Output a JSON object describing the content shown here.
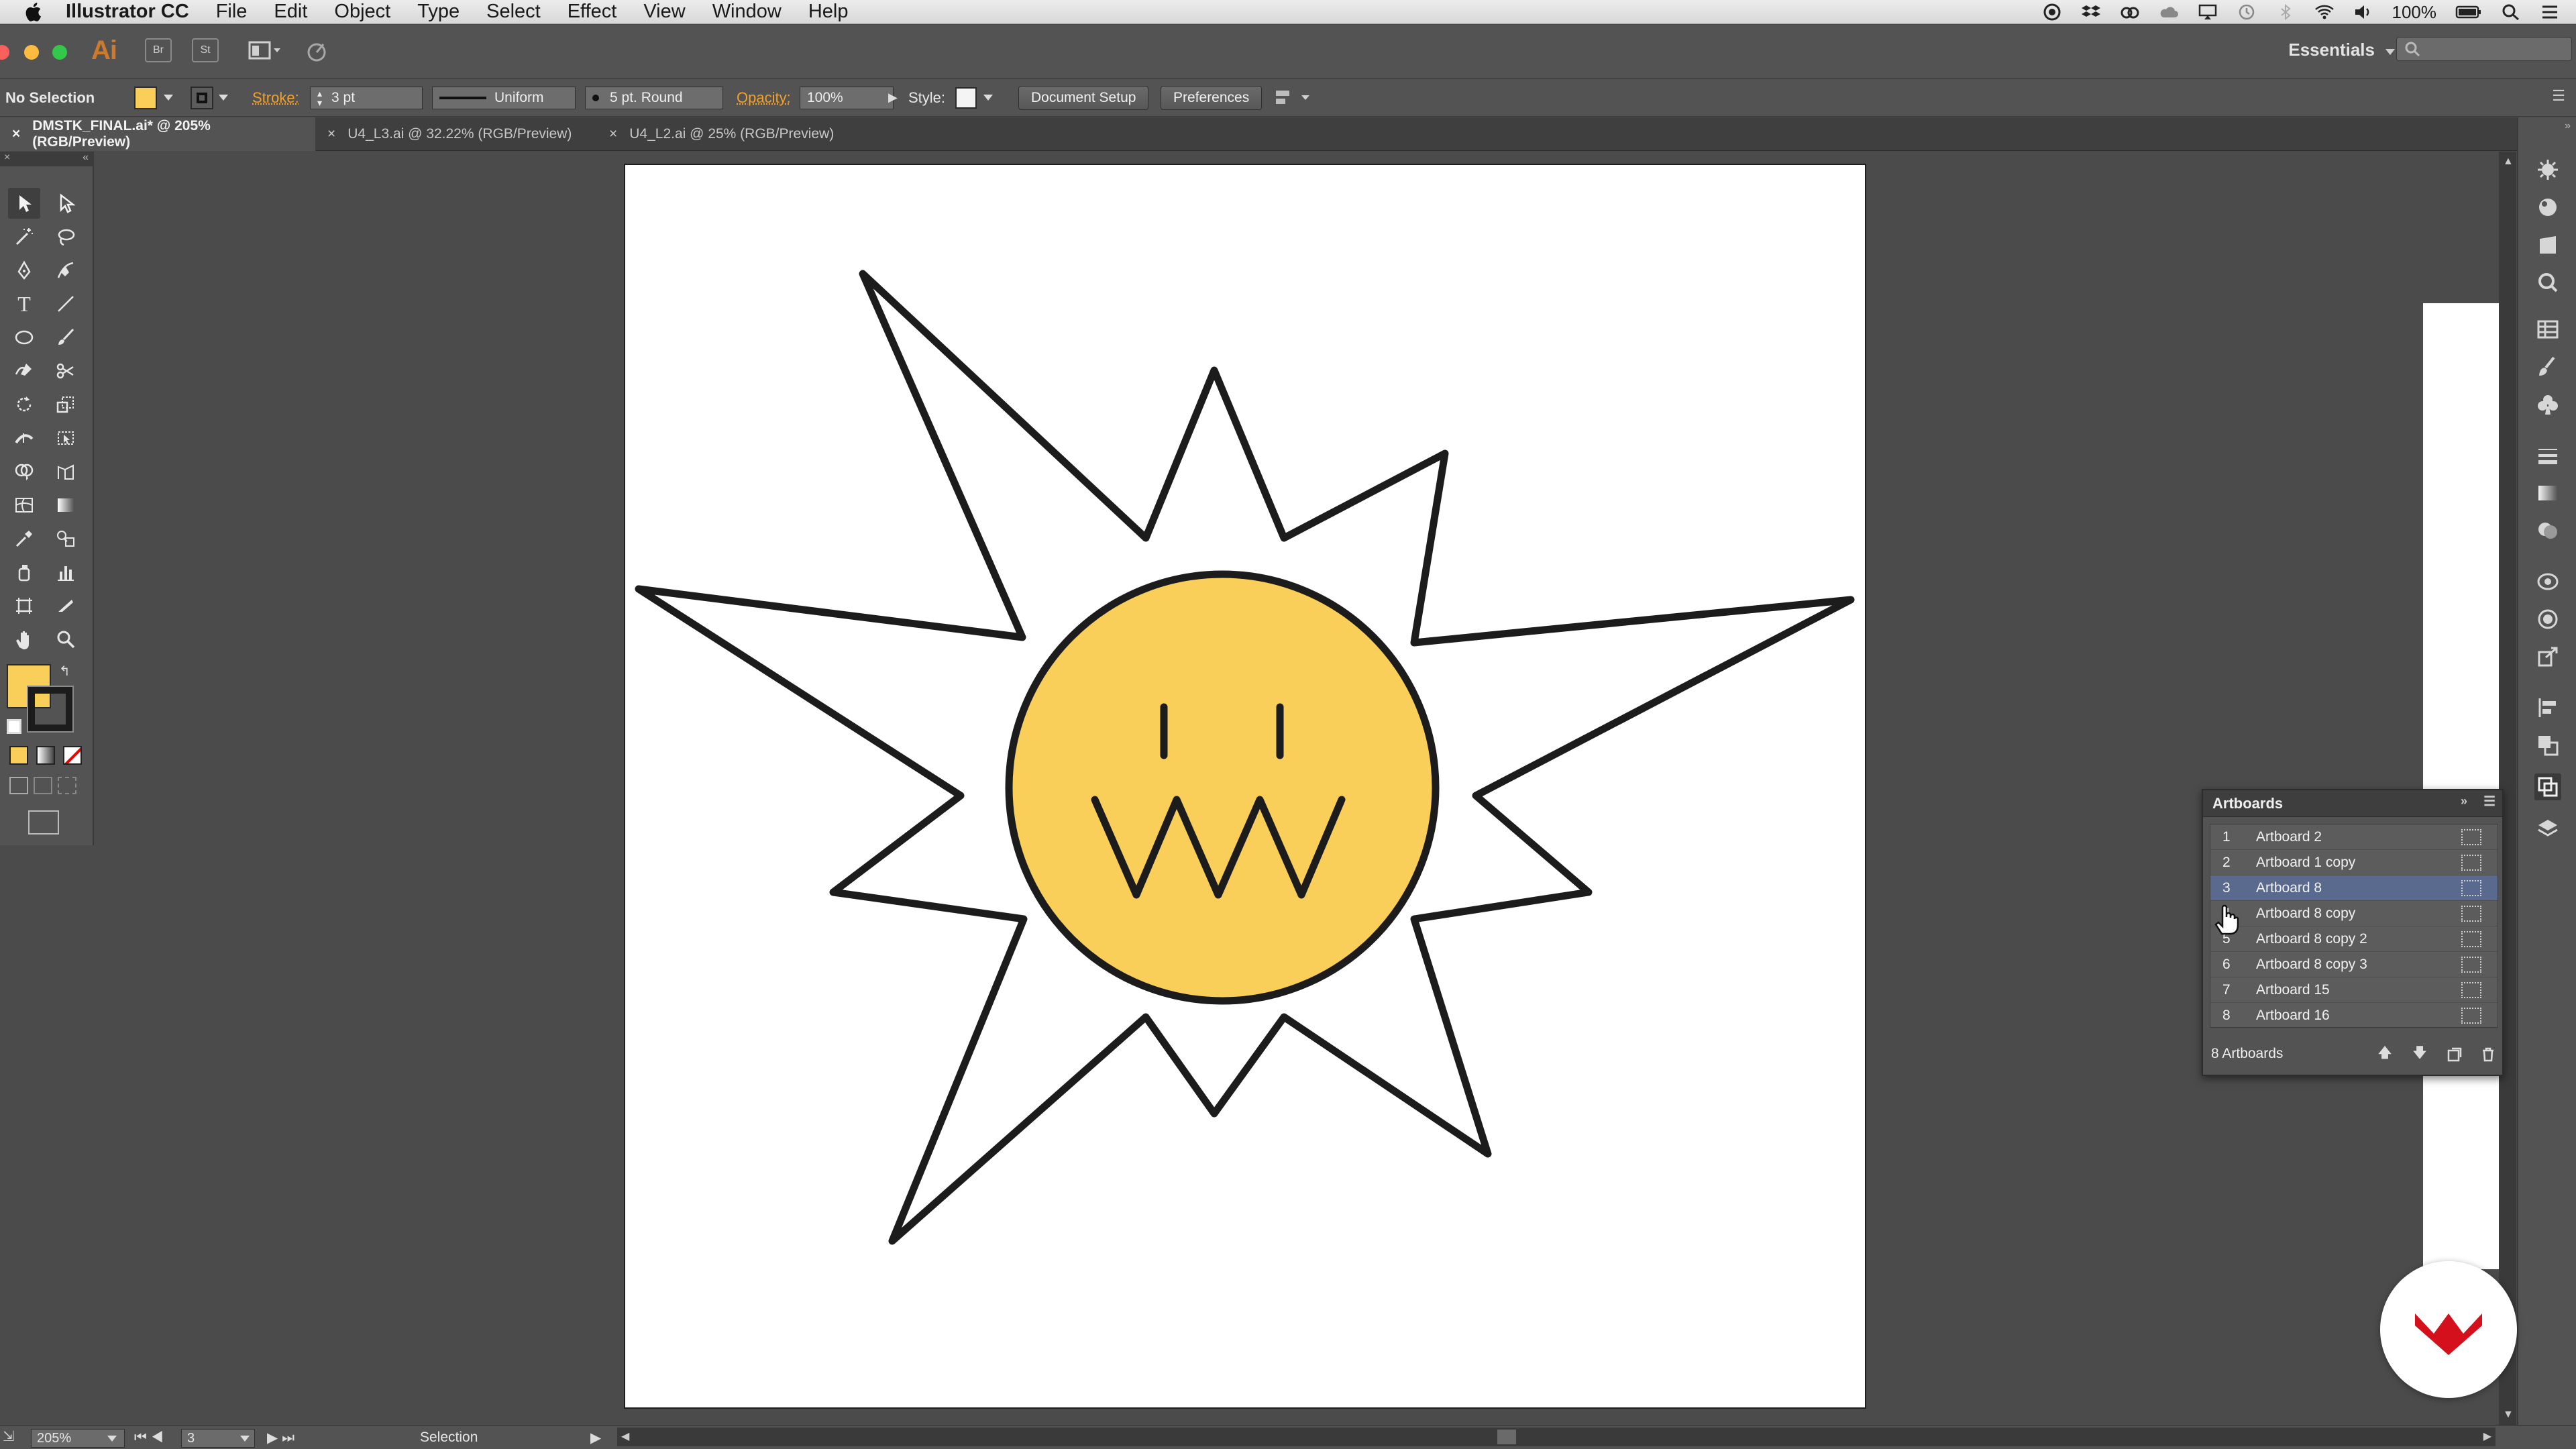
{
  "menubar": {
    "app_name": "Illustrator CC",
    "items": [
      "File",
      "Edit",
      "Object",
      "Type",
      "Select",
      "Effect",
      "View",
      "Window",
      "Help"
    ],
    "battery": "100%"
  },
  "appbar": {
    "logo": "Ai",
    "bridge_label": "Br",
    "stock_label": "St",
    "workspace": "Essentials"
  },
  "control": {
    "selection_label": "No Selection",
    "fill_color": "#f9cf5a",
    "stroke_label": "Stroke:",
    "stroke_weight": "3 pt",
    "profile_label": "Uniform",
    "brush_label": "5 pt. Round",
    "opacity_label": "Opacity:",
    "opacity_value": "100%",
    "style_label": "Style:",
    "document_setup": "Document Setup",
    "preferences": "Preferences"
  },
  "tabs": [
    {
      "label": "DMSTK_FINAL.ai* @ 205% (RGB/Preview)",
      "active": true
    },
    {
      "label": "U4_L3.ai @ 32.22% (RGB/Preview)",
      "active": false
    },
    {
      "label": "U4_L2.ai @ 25% (RGB/Preview)",
      "active": false
    }
  ],
  "artboards_panel": {
    "title": "Artboards",
    "rows": [
      {
        "num": "1",
        "name": "Artboard 2"
      },
      {
        "num": "2",
        "name": "Artboard 1 copy"
      },
      {
        "num": "3",
        "name": "Artboard 8",
        "selected": true
      },
      {
        "num": "4",
        "name": "Artboard 8 copy"
      },
      {
        "num": "5",
        "name": "Artboard 8 copy 2"
      },
      {
        "num": "6",
        "name": "Artboard 8 copy 3"
      },
      {
        "num": "7",
        "name": "Artboard 15"
      },
      {
        "num": "8",
        "name": "Artboard 16"
      }
    ],
    "count_label": "8 Artboards"
  },
  "statusbar": {
    "zoom": "205%",
    "artboard_number": "3",
    "tool_label": "Selection"
  },
  "colors": {
    "face_fill": "#f9cf5a",
    "stroke": "#1c1c1c",
    "badge_red": "#d3101c"
  },
  "icons": {
    "apple": "apple-icon",
    "badge": "brand-badge-icon"
  }
}
